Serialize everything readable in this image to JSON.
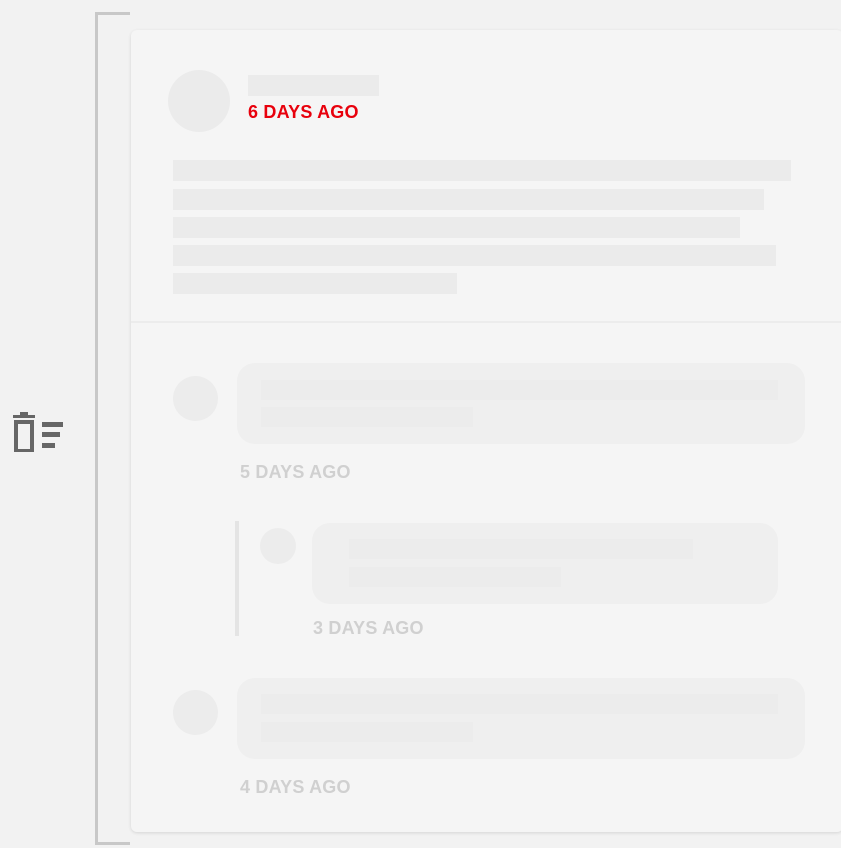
{
  "post": {
    "timestamp": "6 DAYS AGO"
  },
  "comments": [
    {
      "timestamp": "5 DAYS AGO"
    },
    {
      "timestamp": "3 DAYS AGO"
    },
    {
      "timestamp": "4 DAYS AGO"
    }
  ],
  "colors": {
    "accent": "#e8000c",
    "muted_timestamp": "#d0d0d0",
    "skeleton": "#ebebeb",
    "icon": "#666666"
  },
  "icons": {
    "sidebar": "trash-list-icon"
  }
}
